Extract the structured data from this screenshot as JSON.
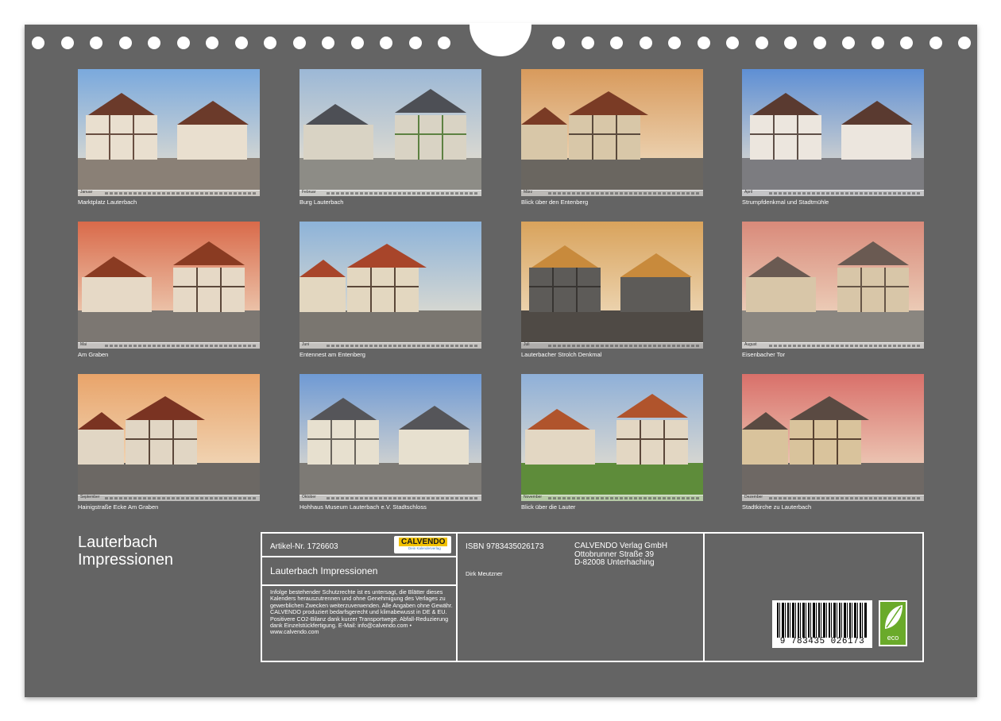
{
  "calendar": {
    "title_line1": "Lauterbach",
    "title_line2": "Impressionen",
    "photos": [
      {
        "caption": "Marktplatz Lauterbach",
        "month": "Januar",
        "sky": "#7aa9dd",
        "ground": "#8a8076",
        "wall": "#e9dfcf",
        "roof": "#6b3a2a",
        "beam": "#4a2a1e"
      },
      {
        "caption": "Burg Lauterbach",
        "month": "Februar",
        "sky": "#9cb8d6",
        "ground": "#8d8c86",
        "wall": "#d9d3c4",
        "roof": "#4d4f55",
        "beam": "#3f6d22"
      },
      {
        "caption": "Blick über den Entenberg",
        "month": "März",
        "sky": "#d89a5c",
        "ground": "#6a6660",
        "wall": "#d8c7a8",
        "roof": "#7a3b25",
        "beam": "#3b2c22"
      },
      {
        "caption": "Strumpfdenkmal und Stadtmühle",
        "month": "April",
        "sky": "#5e8fd4",
        "ground": "#7c7c80",
        "wall": "#ece6de",
        "roof": "#5a3a30",
        "beam": "#3b2a22"
      },
      {
        "caption": "Am Graben",
        "month": "Mai",
        "sky": "#d96a4a",
        "ground": "#7c7772",
        "wall": "#e6d9c6",
        "roof": "#8a3b22",
        "beam": "#3a2418"
      },
      {
        "caption": "Entennest am Entenberg",
        "month": "Juni",
        "sky": "#8db3d9",
        "ground": "#7a7670",
        "wall": "#e3d7c0",
        "roof": "#a8452a",
        "beam": "#3a2418"
      },
      {
        "caption": "Lauterbacher Strolch Denkmal",
        "month": "Juli",
        "sky": "#d9a35c",
        "ground": "#4f4a45",
        "wall": "#5d5b58",
        "roof": "#c88a3c",
        "beam": "#2f2c29"
      },
      {
        "caption": "Eisenbacher Tor",
        "month": "August",
        "sky": "#d98a7a",
        "ground": "#8a8680",
        "wall": "#d8c6a8",
        "roof": "#6a5a52",
        "beam": "#4a3a30"
      },
      {
        "caption": "Hainigstraße Ecke Am Graben",
        "month": "September",
        "sky": "#e9a46a",
        "ground": "#6c6864",
        "wall": "#e1d6c4",
        "roof": "#7a3322",
        "beam": "#3a2418"
      },
      {
        "caption": "Hohhaus Museum Lauterbach e.V. Stadtschloss",
        "month": "Oktober",
        "sky": "#6f9ad4",
        "ground": "#7d7a75",
        "wall": "#e7e0cf",
        "roof": "#555559",
        "beam": "#4a4640"
      },
      {
        "caption": "Blick über die Lauter",
        "month": "November",
        "sky": "#8fb0d8",
        "ground": "#5e8c3a",
        "wall": "#e3d7c3",
        "roof": "#b0542c",
        "beam": "#3a2418"
      },
      {
        "caption": "Stadtkirche zu Lauterbach",
        "month": "Dezember",
        "sky": "#d9706a",
        "ground": "#6e6864",
        "wall": "#d9c39c",
        "roof": "#5a4a42",
        "beam": "#3a2418"
      }
    ]
  },
  "info": {
    "article": "Artikel-Nr. 1726603",
    "logo_text": "CALVENDO",
    "logo_sub": "Dein Kalenderverlag",
    "product_title": "Lauterbach Impressionen",
    "legal_text": "Infolge bestehender Schutzrechte ist es untersagt, die Blätter dieses Kalenders herauszutrennen und ohne Genehmigung des Verlages zu gewerblichen Zwecken weiterzuverwenden. Alle Angaben ohne Gewähr. CALVENDO produziert bedarfsgerecht und klimabewusst in DE & EU. Positivere CO2-Bilanz dank kurzer Transportwege. Abfall-Reduzierung dank Einzelstückfertigung. E-Mail: info@calvendo.com • www.calvendo.com",
    "isbn": "ISBN 9783435026173",
    "author": "Dirk Meutzner",
    "publisher_name": "CALVENDO Verlag GmbH",
    "publisher_street": "Ottobrunner Straße 39",
    "publisher_city": "D-82008 Unterhaching",
    "barcode_digits": "9 783435 026173",
    "eco_label": "eco"
  },
  "colors": {
    "sheet": "#646464",
    "text": "#ffffff",
    "logo_yellow": "#f2c200",
    "eco_green": "#6aaa2a"
  }
}
